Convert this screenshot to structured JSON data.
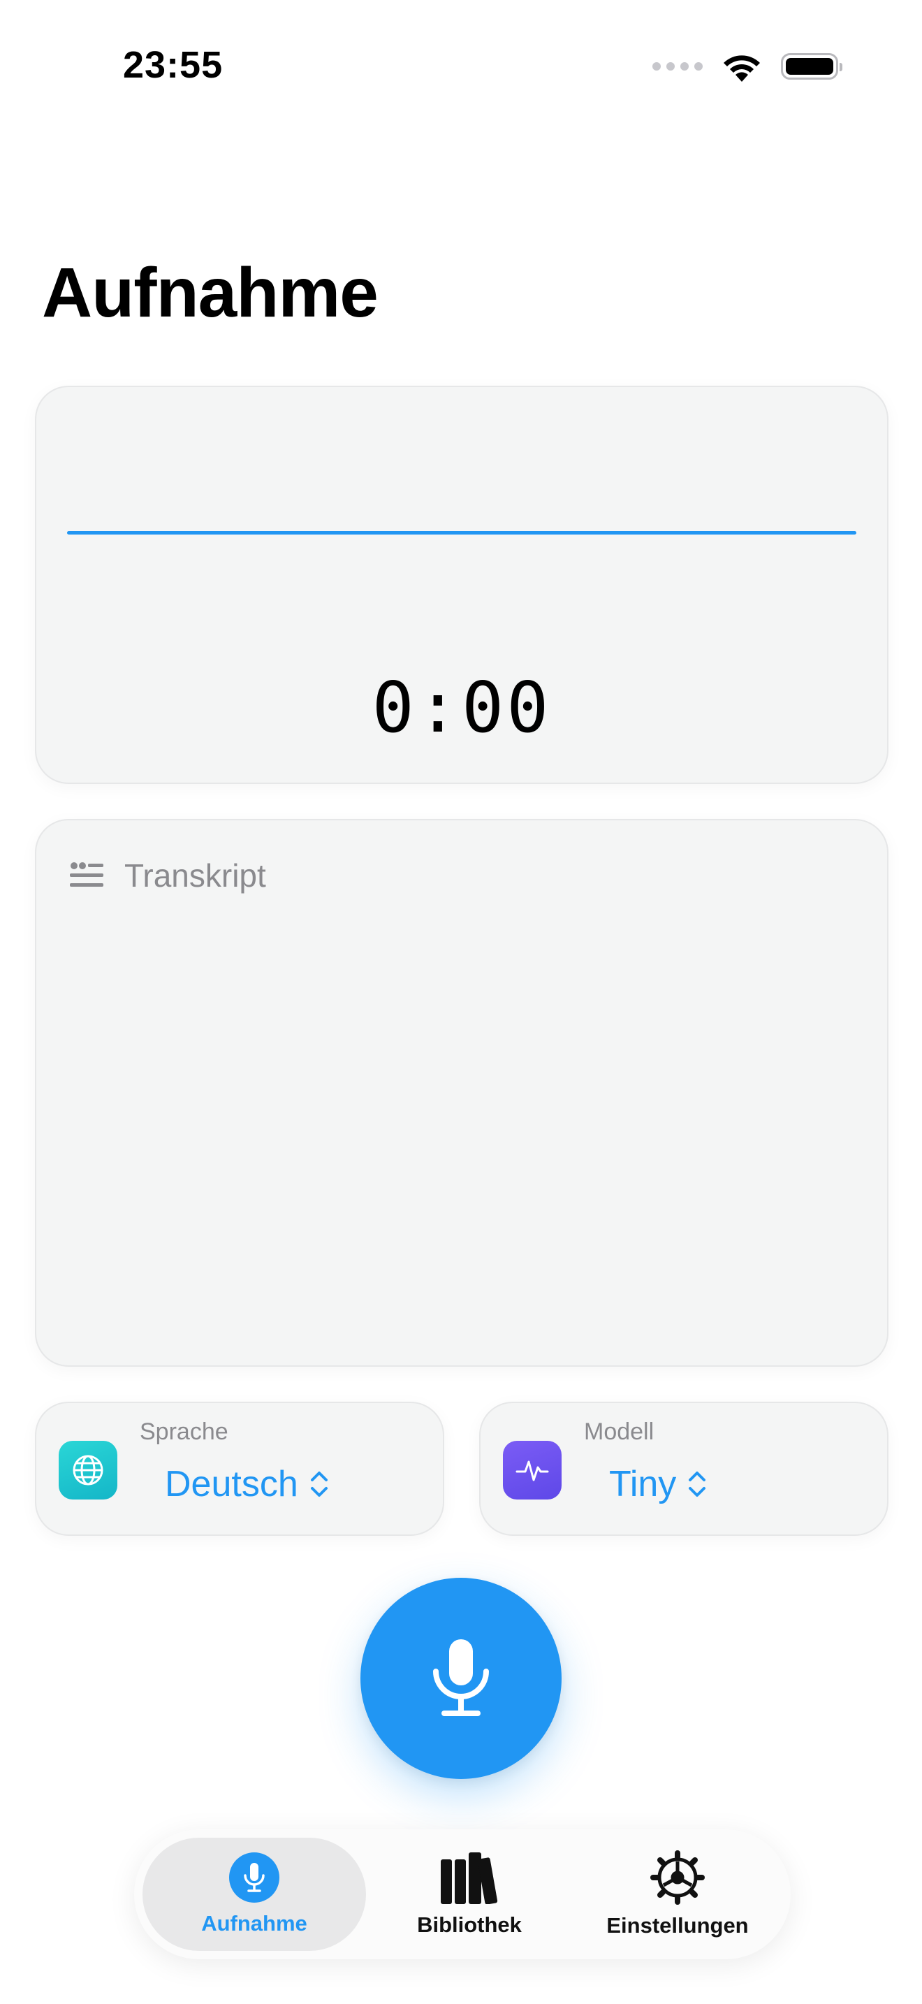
{
  "status_bar": {
    "time": "23:55",
    "icons": [
      "cellular-dots-icon",
      "wifi-icon",
      "battery-icon"
    ]
  },
  "page": {
    "title": "Aufnahme"
  },
  "recorder": {
    "timer": "0:00",
    "waveform_color": "#2196F3"
  },
  "transcript": {
    "icon": "quote-lines-icon",
    "label": "Transkript",
    "text": ""
  },
  "pickers": {
    "language": {
      "caption": "Sprache",
      "value": "Deutsch",
      "icon": "globe-icon",
      "icon_color": "#1CC8CF"
    },
    "model": {
      "caption": "Modell",
      "value": "Tiny",
      "icon": "waveform-pulse-icon",
      "icon_color": "#6E55F2"
    }
  },
  "record_button": {
    "icon": "microphone-icon",
    "color": "#2196F3"
  },
  "tab_bar": {
    "tabs": [
      {
        "label": "Aufnahme",
        "icon": "microphone-icon",
        "selected": true
      },
      {
        "label": "Bibliothek",
        "icon": "books-icon",
        "selected": false
      },
      {
        "label": "Einstellungen",
        "icon": "gear-icon",
        "selected": false
      }
    ]
  },
  "colors": {
    "accent": "#2196F3",
    "card_background": "#F4F5F5",
    "secondary_text": "#8A8A8E"
  }
}
